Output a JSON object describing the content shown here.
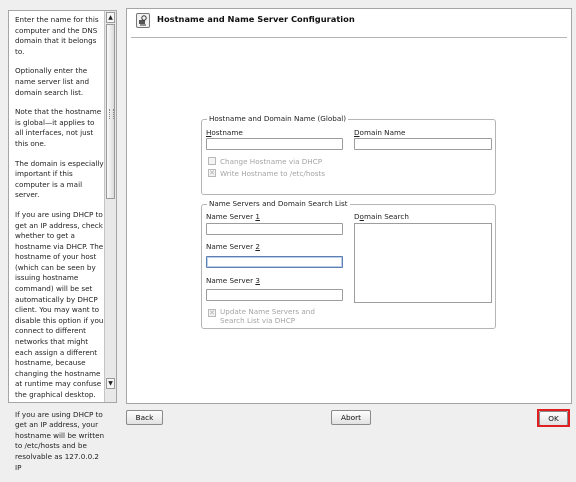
{
  "help": {
    "paragraphs": [
      "Enter the name for this computer and the DNS domain that it belongs to.",
      "Optionally enter the name server list and domain search list.",
      "Note that the hostname is global—it applies to all interfaces, not just this one.",
      "The domain is especially important if this computer is a mail server.",
      "If you are using DHCP to get an IP address, check whether to get a hostname via DHCP. The hostname of your host (which can be seen by issuing hostname command) will be set automatically by DHCP client. You may want to disable this option if you connect to different networks that might each assign a different hostname, because changing the hostname at runtime may confuse the graphical desktop.",
      "If you are using DHCP to get an IP address, your hostname will be written to /etc/hosts and be resolvable as 127.0.0.2 IP"
    ]
  },
  "page": {
    "title": "Hostname and Name Server Configuration",
    "icon": "network-settings-icon"
  },
  "hostname_group": {
    "legend": "Hostname and Domain Name (Global)",
    "hostname_label": "Hostname",
    "hostname_value": "",
    "domain_label": "Domain Name",
    "domain_value": "",
    "change_via_dhcp": {
      "label": "Change Hostname via DHCP",
      "checked": false,
      "enabled": false
    },
    "write_to_hosts": {
      "label": "Write Hostname to /etc/hosts",
      "checked": true,
      "enabled": false
    }
  },
  "nameserver_group": {
    "legend": "Name Servers and Domain Search List",
    "ns1_label": "Name Server 1",
    "ns1_value": "",
    "ns2_label": "Name Server 2",
    "ns2_value": "",
    "ns3_label": "Name Server 3",
    "ns3_value": "",
    "search_label": "Domain Search",
    "search_items": [],
    "update_via_dhcp": {
      "label_line1": "Update Name Servers and",
      "label_line2": "Search List via DHCP",
      "checked": true,
      "enabled": false
    }
  },
  "buttons": {
    "back": "Back",
    "abort": "Abort",
    "ok": "OK"
  },
  "colors": {
    "highlight": "#e02020",
    "focus": "#5b7fb5"
  }
}
